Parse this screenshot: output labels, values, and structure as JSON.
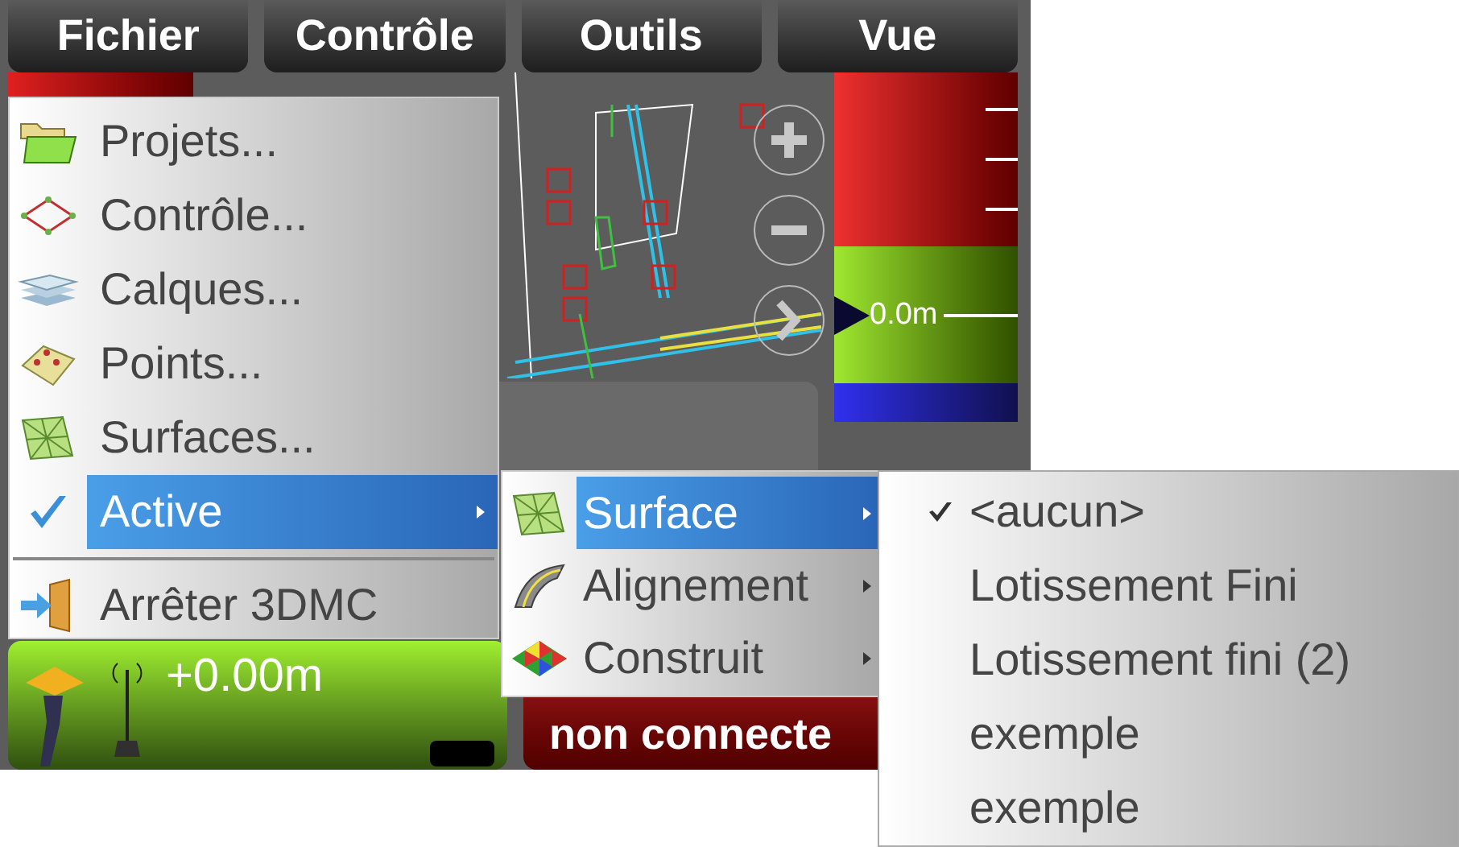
{
  "menubar": [
    {
      "label": "Fichier"
    },
    {
      "label": "Contrôle"
    },
    {
      "label": "Outils"
    },
    {
      "label": "Vue"
    }
  ],
  "scale": {
    "reading": "0.0m"
  },
  "status": {
    "elevation": "+0.00m",
    "connection": "non connecte"
  },
  "main_menu": {
    "items": [
      {
        "label": "Projets...",
        "kind": "icon",
        "selected": false,
        "has_submenu": false
      },
      {
        "label": "Contrôle...",
        "kind": "icon",
        "selected": false,
        "has_submenu": false
      },
      {
        "label": "Calques...",
        "kind": "icon",
        "selected": false,
        "has_submenu": false
      },
      {
        "label": "Points...",
        "kind": "icon",
        "selected": false,
        "has_submenu": false
      },
      {
        "label": "Surfaces...",
        "kind": "icon",
        "selected": false,
        "has_submenu": false
      },
      {
        "label": "Active",
        "kind": "check",
        "selected": true,
        "has_submenu": true
      },
      {
        "label": "Arrêter 3DMC",
        "kind": "icon",
        "selected": false,
        "has_submenu": false,
        "separator_before": true
      }
    ]
  },
  "active_submenu": {
    "items": [
      {
        "label": "Surface",
        "selected": true,
        "has_submenu": true
      },
      {
        "label": "Alignement",
        "selected": false,
        "has_submenu": true
      },
      {
        "label": "Construit",
        "selected": false,
        "has_submenu": true
      }
    ]
  },
  "surface_list": {
    "items": [
      {
        "label": "<aucun>",
        "checked": true
      },
      {
        "label": "Lotissement Fini",
        "checked": false
      },
      {
        "label": "Lotissement fini (2)",
        "checked": false
      },
      {
        "label": "exemple",
        "checked": false
      },
      {
        "label": "exemple",
        "checked": false
      }
    ]
  }
}
